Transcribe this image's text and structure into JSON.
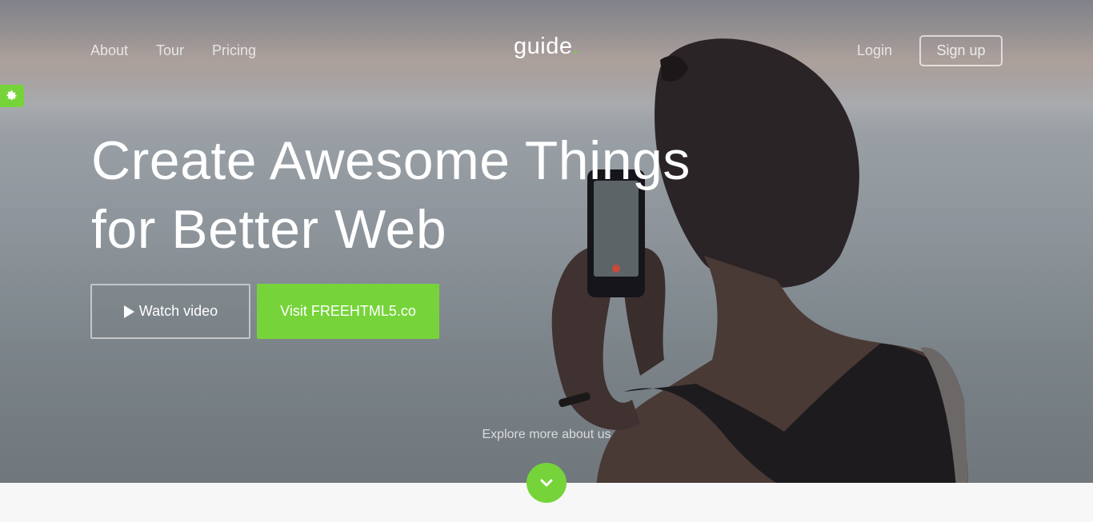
{
  "nav": {
    "left_links": [
      {
        "label": "About"
      },
      {
        "label": "Tour"
      },
      {
        "label": "Pricing"
      }
    ],
    "brand": {
      "text": "guide",
      "dot": "."
    },
    "login_label": "Login",
    "signup_label": "Sign up"
  },
  "settings": {
    "icon": "gear-icon"
  },
  "hero": {
    "headline_line1": "Create Awesome Things",
    "headline_line2": "for Better Web",
    "watch_label": "Watch video",
    "watch_icon": "play-icon",
    "visit_label": "Visit FREEHTML5.co",
    "explore_text": "Explore more about us",
    "scroll_icon": "chevron-down-icon"
  },
  "colors": {
    "accent": "#76d43a",
    "footer_bg": "#f7f7f7"
  }
}
